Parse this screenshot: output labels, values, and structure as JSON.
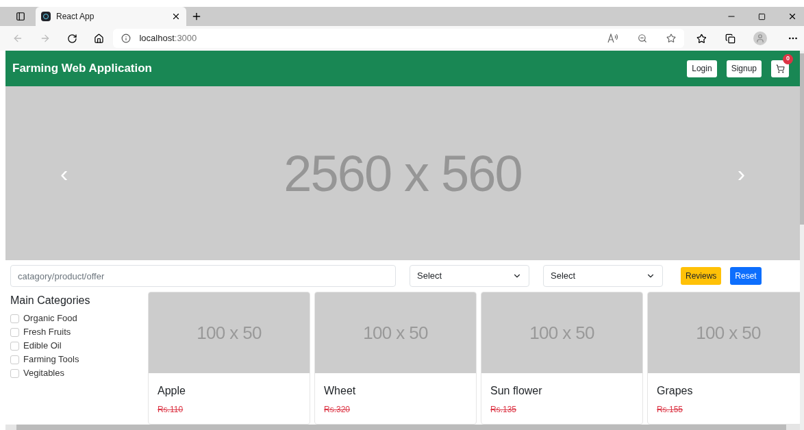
{
  "browser": {
    "tab_title": "React App",
    "url_host": "localhost",
    "url_port": ":3000"
  },
  "header": {
    "title": "Farming Web Application",
    "buttons": [
      "Login",
      "Signup"
    ],
    "cart_count": "0"
  },
  "banner": {
    "label": "2560 x 560",
    "prev": "‹",
    "next": "›"
  },
  "filters": {
    "search_placeholder": "catagory/product/offer",
    "selects": [
      "Select",
      "Select"
    ],
    "buttons": [
      {
        "label": "Reviews",
        "kind": "warning"
      },
      {
        "label": "Reset",
        "kind": "primary"
      }
    ]
  },
  "sidebar": {
    "title": "Main Categories",
    "items": [
      {
        "label": "Organic Food",
        "checked": false
      },
      {
        "label": "Fresh Fruits",
        "checked": false
      },
      {
        "label": "Edible Oil",
        "checked": false
      },
      {
        "label": "Farming Tools",
        "checked": false
      },
      {
        "label": "Vegitables",
        "checked": false
      }
    ]
  },
  "products": [
    {
      "image_label": "100 x 50",
      "name": "Apple",
      "old_price": "Rs.110"
    },
    {
      "image_label": "100 x 50",
      "name": "Wheet",
      "old_price": "Rs.320"
    },
    {
      "image_label": "100 x 50",
      "name": "Sun flower",
      "old_price": "Rs.135"
    },
    {
      "image_label": "100 x 50",
      "name": "Grapes",
      "old_price": "Rs.155"
    }
  ]
}
